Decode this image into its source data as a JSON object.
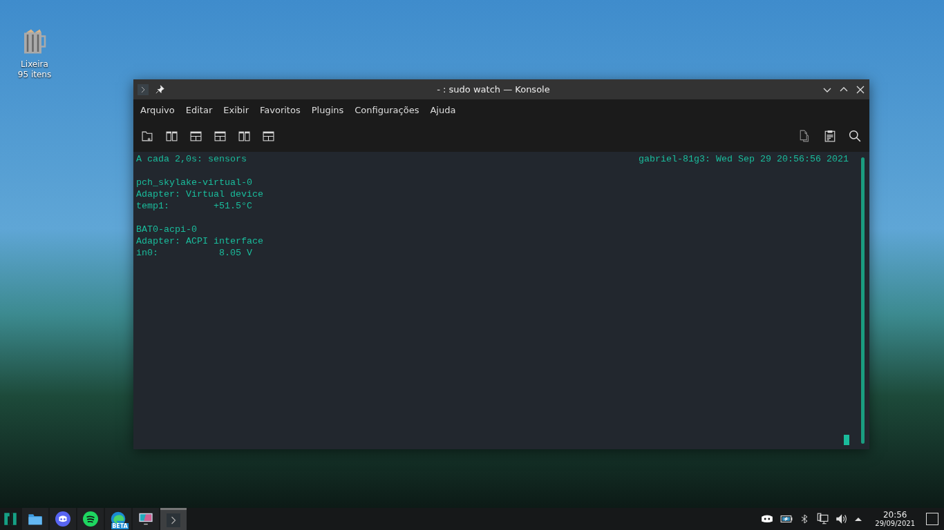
{
  "desktop_icons": [
    {
      "label": "Lixeira",
      "sublabel": "95 itens"
    }
  ],
  "window": {
    "title": "- : sudo watch — Konsole",
    "menu": [
      "Arquivo",
      "Editar",
      "Exibir",
      "Favoritos",
      "Plugins",
      "Configurações",
      "Ajuda"
    ],
    "toolbar_left": [
      {
        "kind": "new-tab"
      },
      {
        "kind": "split-vertical"
      },
      {
        "kind": "split-horizontal"
      },
      {
        "kind": "split-horizontal"
      },
      {
        "kind": "split-vertical"
      },
      {
        "kind": "split-horizontal"
      }
    ],
    "toolbar_right": [
      {
        "kind": "copy"
      },
      {
        "kind": "paste"
      },
      {
        "kind": "search"
      }
    ],
    "terminal": {
      "header_left": "A cada 2,0s: sensors",
      "header_right": "gabriel-81g3: Wed Sep 29 20:56:56 2021",
      "blocks": [
        [
          "pch_skylake-virtual-0",
          "Adapter: Virtual device",
          "temp1:        +51.5°C"
        ],
        [
          "BAT0-acpi-0",
          "Adapter: ACPI interface",
          "in0:           8.05 V"
        ]
      ]
    }
  },
  "taskbar": {
    "items": [
      {
        "kind": "start",
        "selected": false
      },
      {
        "kind": "files",
        "selected": false
      },
      {
        "kind": "discord",
        "selected": false
      },
      {
        "kind": "spotify",
        "selected": false
      },
      {
        "kind": "edge",
        "badge": "BETA",
        "selected": false
      },
      {
        "kind": "monitor",
        "selected": false
      },
      {
        "kind": "terminal",
        "selected": true
      }
    ],
    "tray": [
      {
        "kind": "discord"
      },
      {
        "kind": "battery"
      },
      {
        "kind": "bluetooth"
      },
      {
        "kind": "network"
      },
      {
        "kind": "volume"
      },
      {
        "kind": "expand"
      }
    ],
    "clock": {
      "time": "20:56",
      "date": "29/09/2021"
    }
  }
}
